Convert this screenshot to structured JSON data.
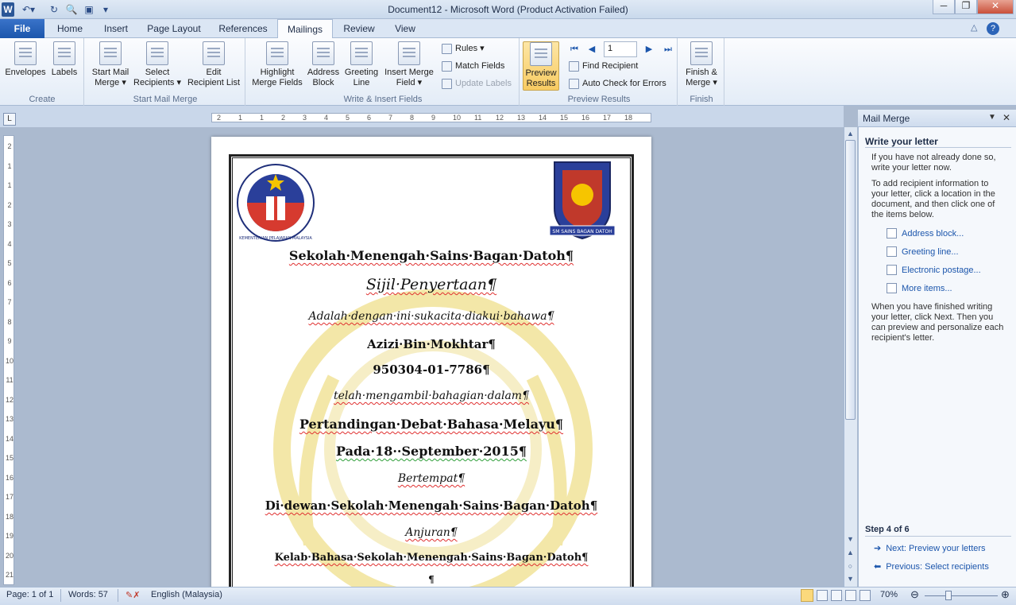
{
  "window": {
    "title": "Document12  -  Microsoft Word (Product Activation Failed)"
  },
  "tabs": [
    "File",
    "Home",
    "Insert",
    "Page Layout",
    "References",
    "Mailings",
    "Review",
    "View"
  ],
  "ribbon": {
    "create": {
      "label": "Create",
      "envelopes": "Envelopes",
      "labels": "Labels"
    },
    "start": {
      "label": "Start Mail Merge",
      "start_mail_merge": [
        "Start Mail",
        "Merge ▾"
      ],
      "select_recipients": [
        "Select",
        "Recipients ▾"
      ],
      "edit_list": [
        "Edit",
        "Recipient List"
      ]
    },
    "write": {
      "label": "Write & Insert Fields",
      "highlight": [
        "Highlight",
        "Merge Fields"
      ],
      "address": [
        "Address",
        "Block"
      ],
      "greeting": [
        "Greeting",
        "Line"
      ],
      "insert_field": [
        "Insert Merge",
        "Field ▾"
      ],
      "rules": "Rules ▾",
      "match_fields": "Match Fields",
      "update_labels": "Update Labels"
    },
    "preview": {
      "label": "Preview Results",
      "preview_results": [
        "Preview",
        "Results"
      ],
      "record": "1",
      "find_recipient": "Find Recipient",
      "auto_check": "Auto Check for Errors"
    },
    "finish": {
      "label": "Finish",
      "finish_merge": [
        "Finish &",
        "Merge ▾"
      ]
    }
  },
  "ruler": {
    "h": [
      "2",
      "1",
      "1",
      "2",
      "3",
      "4",
      "5",
      "6",
      "7",
      "8",
      "9",
      "10",
      "11",
      "12",
      "13",
      "14",
      "15",
      "16",
      "17",
      "18"
    ],
    "v": [
      "2",
      "1",
      "1",
      "2",
      "3",
      "4",
      "5",
      "6",
      "7",
      "8",
      "9",
      "10",
      "11",
      "12",
      "13",
      "14",
      "15",
      "16",
      "17",
      "18",
      "19",
      "20",
      "21"
    ]
  },
  "document": {
    "logo_left_text": "KEMENTERIAN PELAJARAN MALAYSIA",
    "logo_right_text": "SM SAINS BAGAN DATOH",
    "lines": [
      "Sekolah·Menengah·Sains·Bagan·Datoh¶",
      "Sijil·Penyertaan¶",
      "Adalah·dengan·ini·sukacita·diakui·bahawa¶",
      "Azizi·Bin·Mokhtar¶",
      "950304-01-7786¶",
      "telah·mengambil·bahagian·dalam¶",
      "Pertandingan·Debat·Bahasa·Melayu¶",
      "Pada·18··September·2015¶",
      "Bertempat¶",
      "Di·dewan·Sekolah·Menengah·Sains·Bagan·Datoh¶",
      "Anjuran¶",
      "Kelab·Bahasa·Sekolah·Menengah·Sains·Bagan·Datoh¶",
      "¶"
    ]
  },
  "pane": {
    "title": "Mail Merge",
    "heading": "Write your letter",
    "p1": "If you have not already done so, write your letter now.",
    "p2": "To add recipient information to your letter, click a location in the document, and then click one of the items below.",
    "links": [
      "Address block...",
      "Greeting line...",
      "Electronic postage...",
      "More items..."
    ],
    "p3": "When you have finished writing your letter, click Next. Then you can preview and personalize each recipient's letter.",
    "step": "Step 4 of 6",
    "next": "Next: Preview your letters",
    "previous": "Previous: Select recipients"
  },
  "status": {
    "page": "Page: 1 of 1",
    "words": "Words: 57",
    "language": "English (Malaysia)",
    "zoom": "70%"
  },
  "colors": {
    "accent": "#1c56ac",
    "spell": "#e03030",
    "grammar": "#2f9e3a",
    "preview_on": "#f8cb62"
  }
}
